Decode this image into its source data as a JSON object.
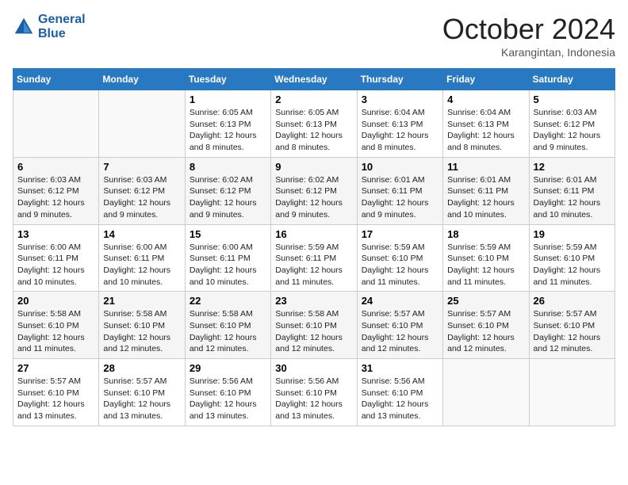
{
  "header": {
    "logo_text_general": "General",
    "logo_text_blue": "Blue",
    "month_title": "October 2024",
    "subtitle": "Karangintan, Indonesia"
  },
  "days_of_week": [
    "Sunday",
    "Monday",
    "Tuesday",
    "Wednesday",
    "Thursday",
    "Friday",
    "Saturday"
  ],
  "weeks": [
    [
      {
        "day": "",
        "info": ""
      },
      {
        "day": "",
        "info": ""
      },
      {
        "day": "1",
        "info": "Sunrise: 6:05 AM\nSunset: 6:13 PM\nDaylight: 12 hours and 8 minutes."
      },
      {
        "day": "2",
        "info": "Sunrise: 6:05 AM\nSunset: 6:13 PM\nDaylight: 12 hours and 8 minutes."
      },
      {
        "day": "3",
        "info": "Sunrise: 6:04 AM\nSunset: 6:13 PM\nDaylight: 12 hours and 8 minutes."
      },
      {
        "day": "4",
        "info": "Sunrise: 6:04 AM\nSunset: 6:13 PM\nDaylight: 12 hours and 8 minutes."
      },
      {
        "day": "5",
        "info": "Sunrise: 6:03 AM\nSunset: 6:12 PM\nDaylight: 12 hours and 9 minutes."
      }
    ],
    [
      {
        "day": "6",
        "info": "Sunrise: 6:03 AM\nSunset: 6:12 PM\nDaylight: 12 hours and 9 minutes."
      },
      {
        "day": "7",
        "info": "Sunrise: 6:03 AM\nSunset: 6:12 PM\nDaylight: 12 hours and 9 minutes."
      },
      {
        "day": "8",
        "info": "Sunrise: 6:02 AM\nSunset: 6:12 PM\nDaylight: 12 hours and 9 minutes."
      },
      {
        "day": "9",
        "info": "Sunrise: 6:02 AM\nSunset: 6:12 PM\nDaylight: 12 hours and 9 minutes."
      },
      {
        "day": "10",
        "info": "Sunrise: 6:01 AM\nSunset: 6:11 PM\nDaylight: 12 hours and 9 minutes."
      },
      {
        "day": "11",
        "info": "Sunrise: 6:01 AM\nSunset: 6:11 PM\nDaylight: 12 hours and 10 minutes."
      },
      {
        "day": "12",
        "info": "Sunrise: 6:01 AM\nSunset: 6:11 PM\nDaylight: 12 hours and 10 minutes."
      }
    ],
    [
      {
        "day": "13",
        "info": "Sunrise: 6:00 AM\nSunset: 6:11 PM\nDaylight: 12 hours and 10 minutes."
      },
      {
        "day": "14",
        "info": "Sunrise: 6:00 AM\nSunset: 6:11 PM\nDaylight: 12 hours and 10 minutes."
      },
      {
        "day": "15",
        "info": "Sunrise: 6:00 AM\nSunset: 6:11 PM\nDaylight: 12 hours and 10 minutes."
      },
      {
        "day": "16",
        "info": "Sunrise: 5:59 AM\nSunset: 6:11 PM\nDaylight: 12 hours and 11 minutes."
      },
      {
        "day": "17",
        "info": "Sunrise: 5:59 AM\nSunset: 6:10 PM\nDaylight: 12 hours and 11 minutes."
      },
      {
        "day": "18",
        "info": "Sunrise: 5:59 AM\nSunset: 6:10 PM\nDaylight: 12 hours and 11 minutes."
      },
      {
        "day": "19",
        "info": "Sunrise: 5:59 AM\nSunset: 6:10 PM\nDaylight: 12 hours and 11 minutes."
      }
    ],
    [
      {
        "day": "20",
        "info": "Sunrise: 5:58 AM\nSunset: 6:10 PM\nDaylight: 12 hours and 11 minutes."
      },
      {
        "day": "21",
        "info": "Sunrise: 5:58 AM\nSunset: 6:10 PM\nDaylight: 12 hours and 12 minutes."
      },
      {
        "day": "22",
        "info": "Sunrise: 5:58 AM\nSunset: 6:10 PM\nDaylight: 12 hours and 12 minutes."
      },
      {
        "day": "23",
        "info": "Sunrise: 5:58 AM\nSunset: 6:10 PM\nDaylight: 12 hours and 12 minutes."
      },
      {
        "day": "24",
        "info": "Sunrise: 5:57 AM\nSunset: 6:10 PM\nDaylight: 12 hours and 12 minutes."
      },
      {
        "day": "25",
        "info": "Sunrise: 5:57 AM\nSunset: 6:10 PM\nDaylight: 12 hours and 12 minutes."
      },
      {
        "day": "26",
        "info": "Sunrise: 5:57 AM\nSunset: 6:10 PM\nDaylight: 12 hours and 12 minutes."
      }
    ],
    [
      {
        "day": "27",
        "info": "Sunrise: 5:57 AM\nSunset: 6:10 PM\nDaylight: 12 hours and 13 minutes."
      },
      {
        "day": "28",
        "info": "Sunrise: 5:57 AM\nSunset: 6:10 PM\nDaylight: 12 hours and 13 minutes."
      },
      {
        "day": "29",
        "info": "Sunrise: 5:56 AM\nSunset: 6:10 PM\nDaylight: 12 hours and 13 minutes."
      },
      {
        "day": "30",
        "info": "Sunrise: 5:56 AM\nSunset: 6:10 PM\nDaylight: 12 hours and 13 minutes."
      },
      {
        "day": "31",
        "info": "Sunrise: 5:56 AM\nSunset: 6:10 PM\nDaylight: 12 hours and 13 minutes."
      },
      {
        "day": "",
        "info": ""
      },
      {
        "day": "",
        "info": ""
      }
    ]
  ]
}
